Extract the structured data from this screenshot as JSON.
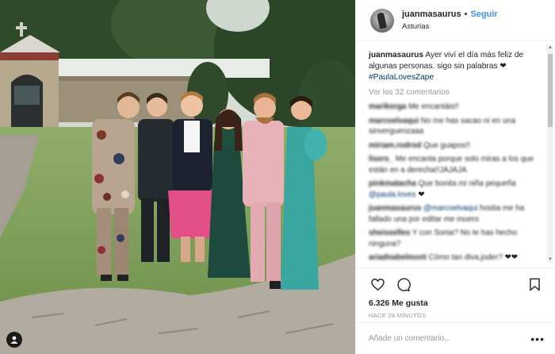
{
  "post": {
    "username": "juanmasaurus",
    "follow_label": "Seguir",
    "separator": "•",
    "location": "Asturias",
    "avatar_icon": "avatar-icon",
    "tag_icon": "user-tag-icon"
  },
  "caption": {
    "username": "juanmasaurus",
    "text": "Ayer viví el día más feliz de algunas personas. sigo sin palabras",
    "emoji": "❤",
    "hashtag": "#PaulaLovesZape"
  },
  "view_all_label": "Ver los 32 comentarios",
  "comments": [
    {
      "user": "marikorga",
      "text": "Me encantáis!!"
    },
    {
      "user": "marcoelvaqui",
      "text": "No me has sacao ni en una sinverguenzaaa"
    },
    {
      "user": "miriam.rodrod",
      "text": "Que guapos!!"
    },
    {
      "user": "lisers_",
      "text": "Me encanta porque solo miras a los que están en a derecha!!JAJAJA"
    },
    {
      "user": "pinkmatacha",
      "text": "Que bonita mi niña pequeña",
      "mention": "@paula.loves",
      "emoji": "❤"
    },
    {
      "user": "juanmasaurus",
      "text": "hostia me ha fallado una por editar me muero",
      "mention": "@marcoelvaqui"
    },
    {
      "user": "sheisselles",
      "text": "Y con Sonia? No te has hecho ninguna?"
    },
    {
      "user": "ariadnabelmont",
      "text": "Cómo tan diva,joder?",
      "emoji": "❤❤"
    }
  ],
  "actions": {
    "like_icon": "heart-icon",
    "comment_icon": "comment-icon",
    "save_icon": "bookmark-icon",
    "likes_text": "6.326 Me gusta",
    "time_ago": "HACE 28 MINUTOS"
  },
  "add_comment": {
    "placeholder": "Añade un comentario...",
    "more_label": "•••"
  },
  "colors": {
    "link_blue": "#3897f0",
    "text": "#262626",
    "muted": "#999999",
    "hashtag": "#003569"
  }
}
